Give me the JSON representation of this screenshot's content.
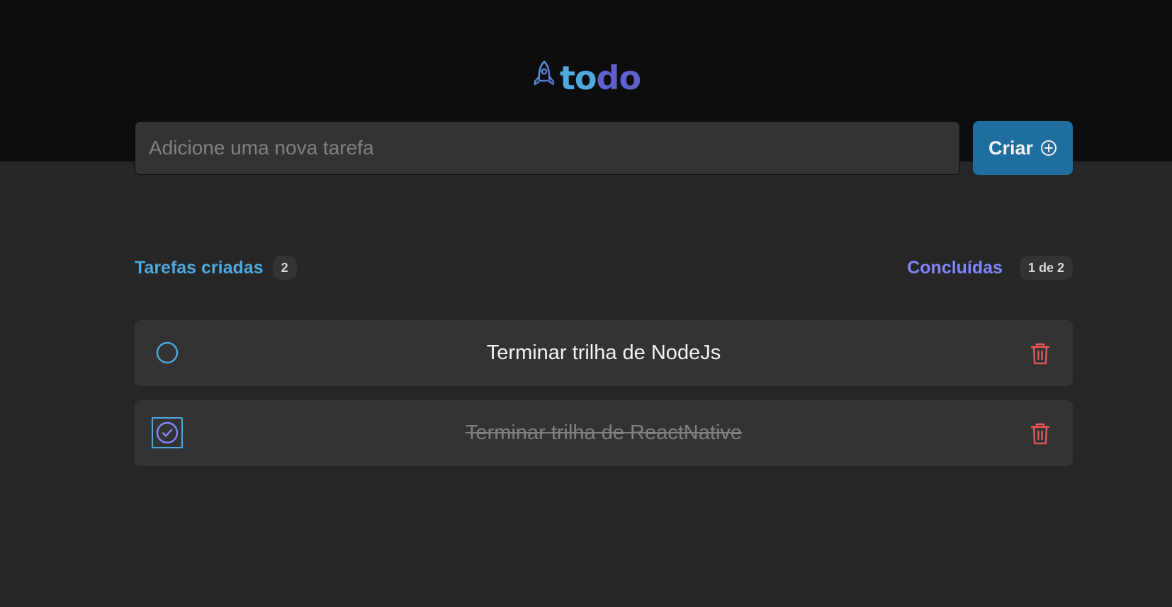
{
  "header": {
    "logo_part1": "to",
    "logo_part2": "do",
    "logo_icon": "rocket-icon"
  },
  "form": {
    "placeholder": "Adicione uma nova tarefa",
    "value": "",
    "create_label": "Criar",
    "create_icon": "plus-circle-icon"
  },
  "summary": {
    "created_label": "Tarefas criadas",
    "created_count": "2",
    "done_label": "Concluídas",
    "done_count": "1 de 2"
  },
  "tasks": [
    {
      "text": "Terminar trilha de NodeJs",
      "completed": false
    },
    {
      "text": "Terminar trilha de ReactNative",
      "completed": true
    }
  ],
  "colors": {
    "blue": "#4ea8de",
    "purple": "#5e60ce",
    "purple_light": "#8284fa",
    "blue_dark": "#1e6f9f",
    "danger": "#e25858",
    "background": "#262626",
    "header_background": "#0d0d0d"
  }
}
